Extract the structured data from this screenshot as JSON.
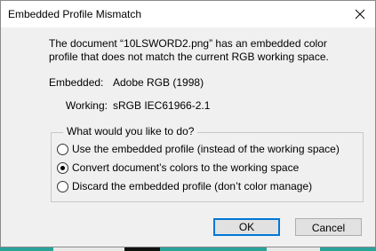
{
  "dialog": {
    "title": "Embedded Profile Mismatch",
    "message_line1": "The document “10LSWORD2.png” has an embedded color",
    "message_line2": "profile that does not match the current RGB working space.",
    "embedded_label": "Embedded:",
    "embedded_value": "Adobe RGB (1998)",
    "working_label": "Working:",
    "working_value": "sRGB IEC61966-2.1",
    "question": "What would you like to do?",
    "options": [
      {
        "label": "Use the embedded profile (instead of the working space)",
        "selected": false
      },
      {
        "label": "Convert document’s colors to the working space",
        "selected": true
      },
      {
        "label": "Discard the embedded profile (don’t color manage)",
        "selected": false
      }
    ],
    "ok_label": "OK",
    "cancel_label": "Cancel"
  },
  "icons": {
    "close": "close-icon"
  },
  "colors": {
    "dialog_bg": "#f0f0f0",
    "titlebar_bg": "#ffffff",
    "default_button_border": "#0078d7",
    "button_bg": "#e1e1e1"
  }
}
